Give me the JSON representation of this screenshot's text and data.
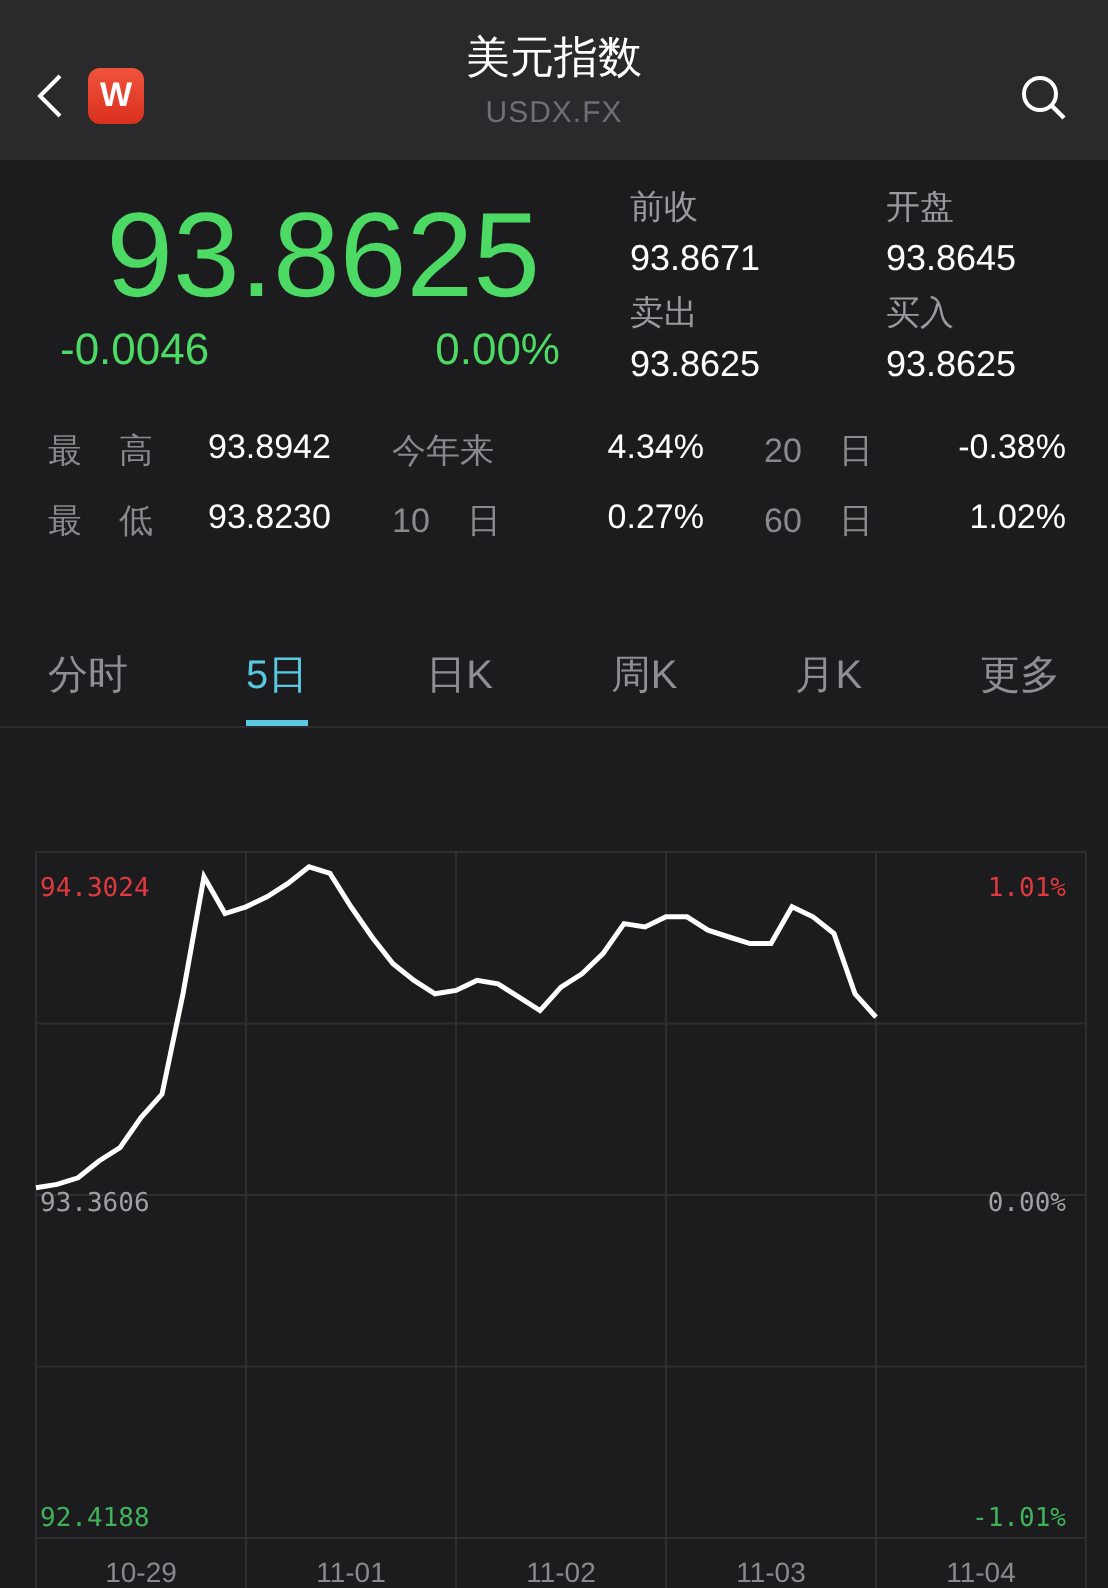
{
  "header": {
    "logo_letter": "W",
    "title": "美元指数",
    "subtitle": "USDX.FX"
  },
  "quote": {
    "price": "93.8625",
    "change": "-0.0046",
    "change_pct": "0.00%"
  },
  "side_stats": [
    {
      "label": "前收",
      "value": "93.8671"
    },
    {
      "label": "开盘",
      "value": "93.8645"
    },
    {
      "label": "卖出",
      "value": "93.8625"
    },
    {
      "label": "买入",
      "value": "93.8625"
    }
  ],
  "stats": [
    {
      "label": "最 高",
      "value": "93.8942"
    },
    {
      "label": "今年来",
      "value": "4.34%"
    },
    {
      "label": "20 日",
      "value": "-0.38%"
    },
    {
      "label": "最 低",
      "value": "93.8230"
    },
    {
      "label": "10 日",
      "value": "0.27%"
    },
    {
      "label": "60 日",
      "value": "1.02%"
    }
  ],
  "tabs": [
    {
      "label": "分时",
      "selected": false
    },
    {
      "label": "5日",
      "selected": true
    },
    {
      "label": "日K",
      "selected": false
    },
    {
      "label": "周K",
      "selected": false
    },
    {
      "label": "月K",
      "selected": false
    },
    {
      "label": "更多",
      "selected": false
    }
  ],
  "chart": {
    "chart_data": {
      "type": "line",
      "grid": true,
      "ylim": [
        92.353,
        94.404
      ],
      "categories": [
        null,
        null,
        null,
        null,
        null,
        "10-29",
        null,
        null,
        null,
        null,
        null,
        null,
        null,
        null,
        null,
        "11-01",
        null,
        null,
        null,
        null,
        null,
        null,
        null,
        null,
        null,
        "11-02",
        null,
        null,
        null,
        null,
        null,
        null,
        null,
        null,
        null,
        "11-03",
        null,
        null,
        null,
        null,
        null,
        null,
        null,
        null,
        null,
        "11-04",
        null,
        null,
        null,
        null
      ],
      "series": [
        {
          "color": "#ffffff",
          "values": [
            93.4,
            93.41,
            93.43,
            93.48,
            93.52,
            93.61,
            93.68,
            93.98,
            94.33,
            94.22,
            94.24,
            94.27,
            94.31,
            94.36,
            94.34,
            94.24,
            94.15,
            94.07,
            94.02,
            93.98,
            93.99,
            94.02,
            94.01,
            93.97,
            93.93,
            94.0,
            94.04,
            94.1,
            94.19,
            94.18,
            94.21,
            94.21,
            94.17,
            94.15,
            94.13,
            94.13,
            94.24,
            94.21,
            94.16,
            93.98,
            93.91,
            null,
            null,
            null,
            null,
            null,
            null,
            null,
            null,
            null
          ]
        }
      ],
      "yticks": [
        {
          "value": 94.3024,
          "label": "94.3024"
        },
        {
          "value": 93.3606,
          "label": "93.3606"
        },
        {
          "value": 92.4188,
          "label": "92.4188"
        }
      ],
      "y2lim": [
        -1.081,
        1.119
      ],
      "y2ticks": [
        {
          "value": 1.01,
          "label": "1.01%"
        },
        {
          "value": 0,
          "label": "0.00%"
        },
        {
          "value": -1.01,
          "label": "-1.01%"
        }
      ]
    }
  }
}
